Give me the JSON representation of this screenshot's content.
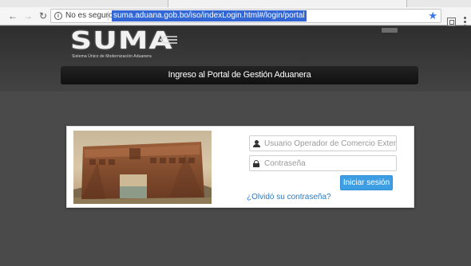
{
  "browser": {
    "security_label": "No es seguro",
    "url": "suma.aduana.gob.bo/iso/indexLogin.html#/login/portal",
    "back_icon": "arrow-left",
    "forward_icon": "arrow-right",
    "reload_icon": "reload",
    "info_icon": "info-circle",
    "star_icon": "star",
    "extension_icon": "cast",
    "menu_icon": "vertical-dots",
    "accent": "#3367d6"
  },
  "header": {
    "logo_text": "SUMA",
    "logo_subtitle": "Sistema Único de Modernización Aduanera",
    "title": "Ingreso al Portal de Gestión Aduanera"
  },
  "login": {
    "username_placeholder": "Usuario Operador de Comercio Exterior",
    "password_placeholder": "Contraseña",
    "submit_label": "Iniciar sesión",
    "forgot_label": "¿Olvidó su contraseña?",
    "button_color": "#3d9ee4",
    "link_color": "#2a7cc7",
    "user_icon": "user",
    "password_icon": "lock"
  }
}
